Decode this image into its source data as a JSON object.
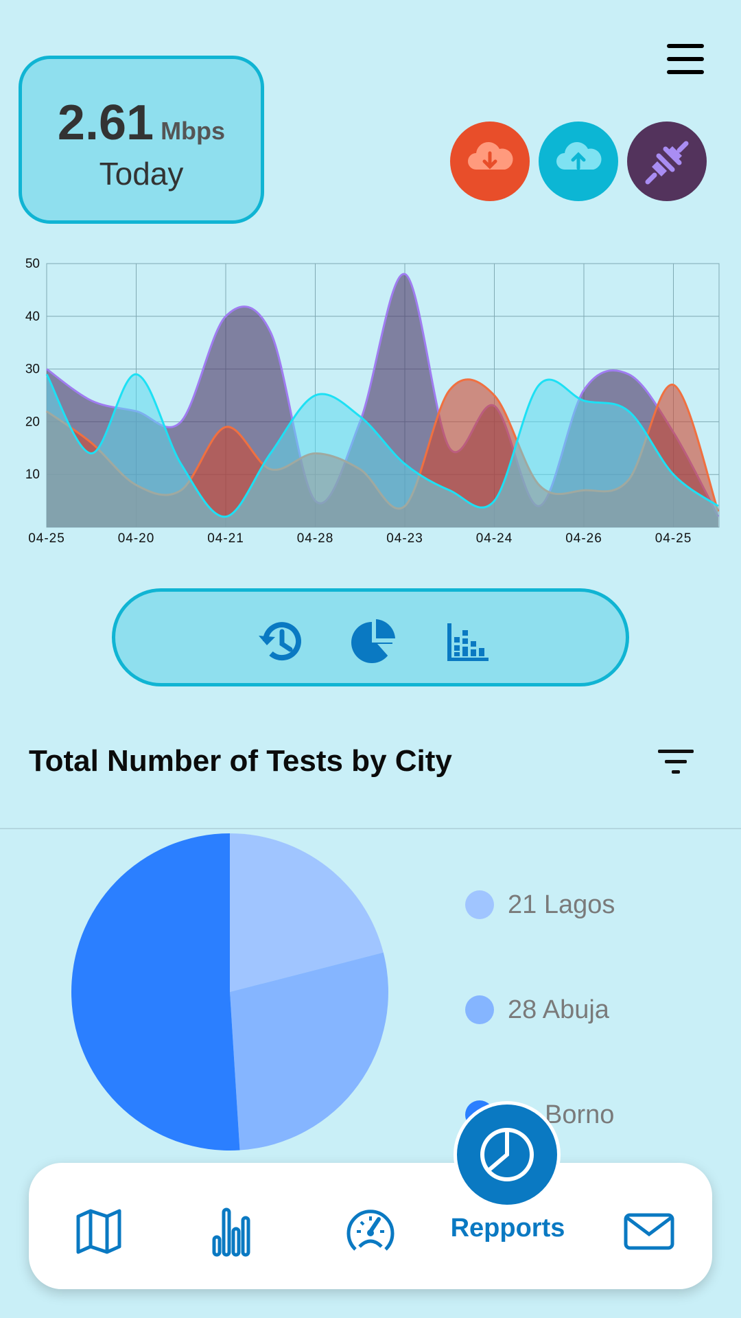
{
  "speed": {
    "value": "2.61",
    "unit": "Mbps",
    "label": "Today"
  },
  "actions": [
    {
      "name": "download",
      "icon": "cloud-download-icon",
      "color": "#e84e2a"
    },
    {
      "name": "upload",
      "icon": "cloud-upload-icon",
      "color": "#0cb6d4"
    },
    {
      "name": "connection",
      "icon": "plug-icon",
      "color": "#53335c"
    }
  ],
  "view_switch": [
    {
      "icon": "history-icon"
    },
    {
      "icon": "pie-chart-icon"
    },
    {
      "icon": "bar-chart-icon"
    }
  ],
  "section": {
    "title": "Total Number of Tests by City",
    "filter_icon": "filter-icon"
  },
  "colors": {
    "accent": "#0a79c2",
    "background": "#c9eff7",
    "card": "#8fdfee",
    "card_border": "#10b4d3"
  },
  "chart_data": [
    {
      "type": "area",
      "categories": [
        "04-25",
        "04-20",
        "04-21",
        "04-28",
        "04-23",
        "04-24",
        "04-26",
        "04-25"
      ],
      "ylim": [
        0,
        50
      ],
      "yticks": [
        10,
        20,
        30,
        40,
        50
      ],
      "grid": true,
      "series": [
        {
          "color": "#4e3565",
          "stroke": "#9f7cf0",
          "x": [
            0,
            0.5,
            1,
            1.5,
            2,
            2.5,
            3,
            3.5,
            4,
            4.5,
            5,
            5.5,
            6,
            6.5,
            7,
            7.5
          ],
          "values": [
            30,
            24,
            22,
            20,
            40,
            37,
            5,
            20,
            48,
            15,
            23,
            4,
            26,
            29,
            18,
            2
          ]
        },
        {
          "color": "#cf4a32",
          "stroke": "#f07040",
          "x": [
            0,
            0.5,
            1,
            1.5,
            2,
            2.5,
            3,
            3.5,
            4,
            4.5,
            5,
            5.5,
            6,
            6.5,
            7,
            7.5
          ],
          "values": [
            22,
            16,
            8,
            7,
            19,
            11,
            14,
            11,
            4,
            26,
            25,
            8,
            7,
            9,
            27,
            3
          ]
        },
        {
          "color": "#5ed8ee",
          "stroke": "#1de0f4",
          "x": [
            0,
            0.5,
            1,
            1.5,
            2,
            2.5,
            3,
            3.5,
            4,
            4.5,
            5,
            5.5,
            6,
            6.5,
            7,
            7.5
          ],
          "values": [
            29,
            14,
            29,
            12,
            2,
            14,
            25,
            21,
            12,
            7,
            5,
            27,
            24,
            22,
            10,
            4
          ]
        }
      ]
    },
    {
      "type": "pie",
      "categories": [
        "Lagos",
        "Abuja",
        "Borno"
      ],
      "values": [
        21,
        28,
        51
      ],
      "colors": [
        "#a0c5ff",
        "#85b5ff",
        "#2b7fff"
      ],
      "legend": [
        {
          "text": "21 Lagos",
          "color": "#a0c5ff"
        },
        {
          "text": "28 Abuja",
          "color": "#85b5ff"
        },
        {
          "text": "Borno",
          "color": "#2b7fff"
        }
      ]
    }
  ],
  "bottom_nav": {
    "items": [
      {
        "icon": "map-icon"
      },
      {
        "icon": "bar-chart-icon"
      },
      {
        "icon": "speedometer-icon"
      },
      {
        "icon": "reports-icon",
        "label": "Repports",
        "active": true
      },
      {
        "icon": "mail-icon"
      }
    ]
  }
}
